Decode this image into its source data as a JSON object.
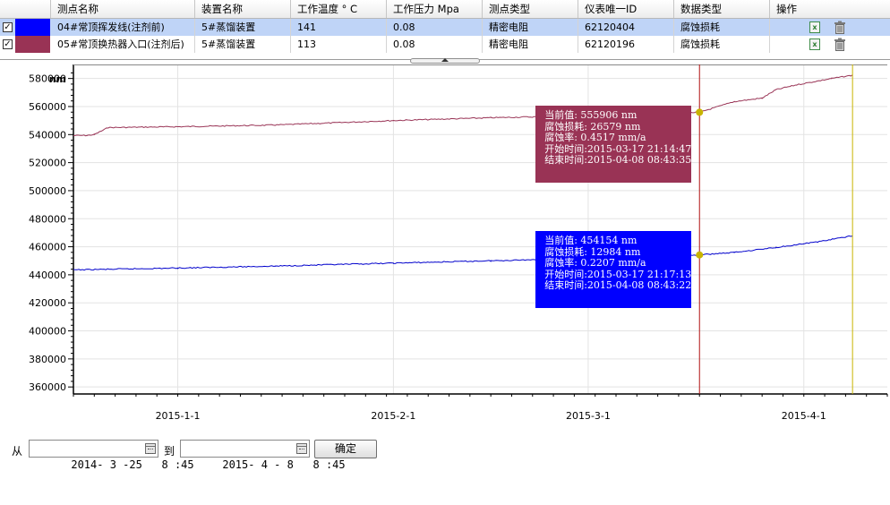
{
  "table": {
    "headers": [
      "测点名称",
      "装置名称",
      "工作温度 ° C",
      "工作压力 Mpa",
      "测点类型",
      "仪表唯一ID",
      "数据类型",
      "操作"
    ],
    "rows": [
      {
        "checked": true,
        "color": "#0000ff",
        "name": "04#常顶挥发线(注剂前)",
        "device": "5#蒸馏装置",
        "temp": "141",
        "pressure": "0.08",
        "type": "精密电阻",
        "meter_id": "62120404",
        "data_type": "腐蚀损耗",
        "selected": true
      },
      {
        "checked": true,
        "color": "#993355",
        "name": "05#常顶换热器入口(注剂后)",
        "device": "5#蒸馏装置",
        "temp": "113",
        "pressure": "0.08",
        "type": "精密电阻",
        "meter_id": "62120196",
        "data_type": "腐蚀损耗",
        "selected": false
      }
    ]
  },
  "icons": {
    "export": "excel-export-icon",
    "delete": "trash-icon",
    "date_picker": "calendar-icon"
  },
  "chart_data": {
    "type": "line",
    "ylabel": "nm",
    "ylim": [
      355000,
      590000
    ],
    "yticks": [
      360000,
      380000,
      400000,
      420000,
      440000,
      460000,
      480000,
      500000,
      520000,
      540000,
      560000,
      580000
    ],
    "xlim": [
      "2014-12-17",
      "2015-04-13"
    ],
    "xticks": [
      {
        "date": "2015-01-01",
        "label": "2015-1-1"
      },
      {
        "date": "2015-02-01",
        "label": "2015-2-1"
      },
      {
        "date": "2015-03-01",
        "label": "2015-3-1"
      },
      {
        "date": "2015-04-01",
        "label": "2015-4-1"
      }
    ],
    "grid": true,
    "series": [
      {
        "name": "05#常顶换热器入口(注剂后)",
        "color": "#993355",
        "points": [
          [
            "2014-12-17",
            539300
          ],
          [
            "2014-12-19",
            539400
          ],
          [
            "2014-12-20",
            540000
          ],
          [
            "2014-12-22",
            545000
          ],
          [
            "2015-01-01",
            545600
          ],
          [
            "2015-01-15",
            546800
          ],
          [
            "2015-02-01",
            550000
          ],
          [
            "2015-02-15",
            552000
          ],
          [
            "2015-03-01",
            553500
          ],
          [
            "2015-03-10",
            554600
          ],
          [
            "2015-03-17",
            555906
          ],
          [
            "2015-03-22",
            563500
          ],
          [
            "2015-03-26",
            566000
          ],
          [
            "2015-03-28",
            572000
          ],
          [
            "2015-03-31",
            575500
          ],
          [
            "2015-04-05",
            580000
          ],
          [
            "2015-04-08",
            582300
          ]
        ]
      },
      {
        "name": "04#常顶挥发线(注剂前)",
        "color": "#0000cc",
        "points": [
          [
            "2014-12-17",
            443500
          ],
          [
            "2015-01-01",
            444800
          ],
          [
            "2015-01-15",
            446200
          ],
          [
            "2015-02-01",
            448300
          ],
          [
            "2015-02-15",
            450000
          ],
          [
            "2015-03-01",
            451800
          ],
          [
            "2015-03-10",
            453000
          ],
          [
            "2015-03-17",
            454154
          ],
          [
            "2015-03-22",
            456000
          ],
          [
            "2015-03-28",
            459500
          ],
          [
            "2015-04-03",
            463500
          ],
          [
            "2015-04-08",
            467800
          ]
        ]
      }
    ],
    "cursor_lines": [
      {
        "date": "2015-03-17",
        "color": "#b01010"
      },
      {
        "date": "2015-04-08",
        "color": "#c8b400"
      }
    ],
    "markers": [
      {
        "date": "2015-03-17",
        "value": 555906,
        "color": "#c8b400"
      },
      {
        "date": "2015-03-17",
        "value": 454154,
        "color": "#c8b400"
      }
    ],
    "tooltips": [
      {
        "background": "#993355",
        "lines": [
          "当前值: 555906 nm",
          "腐蚀损耗: 26579 nm",
          "腐蚀率: 0.4517 mm/a",
          "开始时间:2015-03-17 21:14:47",
          "结束时间:2015-04-08 08:43:35"
        ]
      },
      {
        "background": "#0000ff",
        "lines": [
          "当前值: 454154 nm",
          "腐蚀损耗: 12984 nm",
          "腐蚀率: 0.2207 mm/a",
          "开始时间:2015-03-17 21:17:13",
          "结束时间:2015-04-08 08:43:22"
        ]
      }
    ]
  },
  "footer": {
    "from_label": "从",
    "from_value": "2014- 3 -25   8 :45",
    "to_label": "到",
    "to_value": "2015- 4 - 8   8 :45",
    "confirm_label": "确定"
  }
}
